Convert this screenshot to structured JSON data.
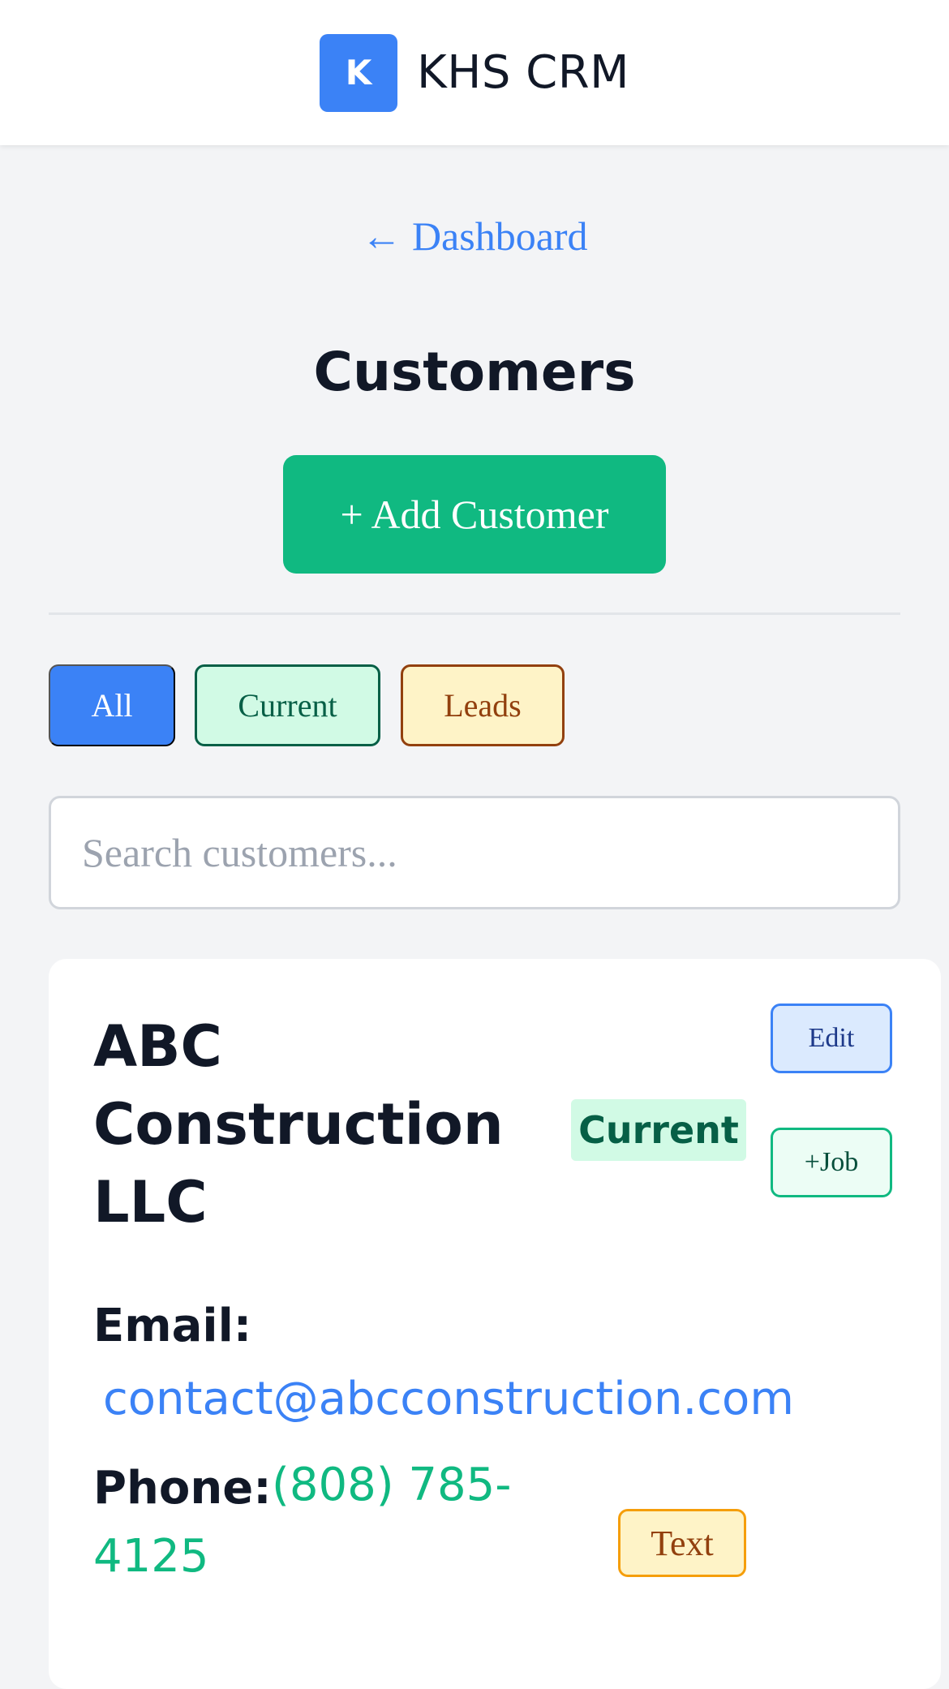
{
  "header": {
    "logo_letter": "K",
    "app_title": "KHS CRM"
  },
  "nav": {
    "back_label": "← Dashboard"
  },
  "page": {
    "title": "Customers",
    "add_button_label": "+ Add Customer"
  },
  "filters": {
    "all_label": "All",
    "current_label": "Current",
    "leads_label": "Leads",
    "selected": "All"
  },
  "search": {
    "placeholder": "Search customers...",
    "value": ""
  },
  "customers": [
    {
      "name": "ABC Construction LLC",
      "status": "Current",
      "edit_label": "Edit",
      "job_label": "+Job",
      "email_label": "Email:",
      "email": "contact@abcconstruction.com",
      "phone_label": "Phone:",
      "phone": "(808) 785-4125",
      "text_label": "Text"
    }
  ],
  "colors": {
    "primary": "#3b82f6",
    "success": "#10b981",
    "warning": "#f59e0b",
    "background": "#f3f4f6",
    "text": "#111827"
  }
}
